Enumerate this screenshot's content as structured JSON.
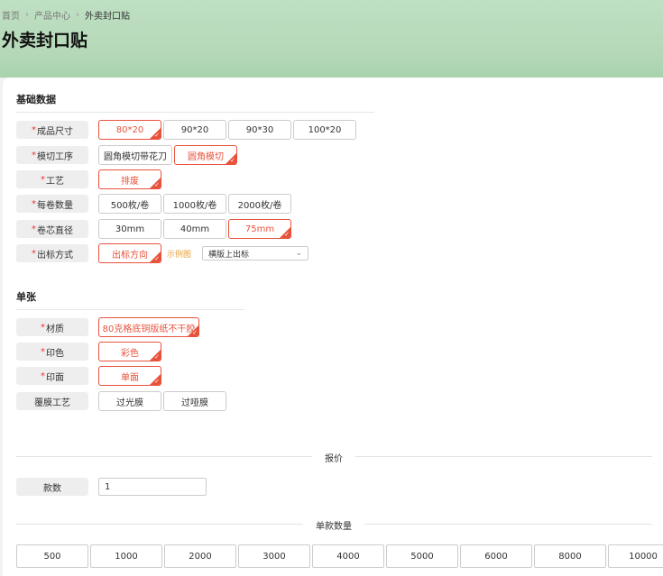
{
  "breadcrumb": {
    "home": "首页",
    "sep": "›",
    "category": "产品中心",
    "current": "外卖封口贴"
  },
  "page_title": "外卖封口贴",
  "sections": {
    "basic": "基础数据",
    "single": "单张"
  },
  "rows": {
    "size": {
      "label": "成品尺寸",
      "required": true,
      "options": [
        "80*20",
        "90*20",
        "90*30",
        "100*20"
      ],
      "selected": 0
    },
    "diecut": {
      "label": "模切工序",
      "required": true,
      "options": [
        "圆角模切带花刀",
        "圆角模切"
      ],
      "selected": 1
    },
    "craft": {
      "label": "工艺",
      "required": true,
      "options": [
        "排废"
      ],
      "selected": 0
    },
    "per_roll": {
      "label": "每卷数量",
      "required": true,
      "options": [
        "500枚/卷",
        "1000枚/卷",
        "2000枚/卷"
      ],
      "selected": -1
    },
    "core": {
      "label": "卷芯直径",
      "required": true,
      "options": [
        "30mm",
        "40mm",
        "75mm"
      ],
      "selected": 2
    },
    "out_dir": {
      "label": "出标方式",
      "required": true,
      "options": [
        "出标方向"
      ],
      "selected": 0,
      "example_link": "示例图",
      "select_value": "横版上出标"
    },
    "material": {
      "label": "材质",
      "required": true,
      "options": [
        "80克格底铜版纸不干胶"
      ],
      "selected": 0
    },
    "print_color": {
      "label": "印色",
      "required": true,
      "options": [
        "彩色"
      ],
      "selected": 0
    },
    "print_side": {
      "label": "印面",
      "required": true,
      "options": [
        "单面"
      ],
      "selected": 0
    },
    "lamination": {
      "label": "覆膜工艺",
      "required": false,
      "options": [
        "过光膜",
        "过哑膜"
      ],
      "selected": -1
    }
  },
  "quote": {
    "divider": "报价",
    "count_label": "款数",
    "count_value": "1"
  },
  "quantity": {
    "divider": "单款数量",
    "options": [
      "500",
      "1000",
      "2000",
      "3000",
      "4000",
      "5000",
      "6000",
      "8000",
      "10000"
    ]
  },
  "colors": {
    "accent": "#e8523c",
    "link": "#e8a23c",
    "header_green": "#b5d8b8"
  }
}
